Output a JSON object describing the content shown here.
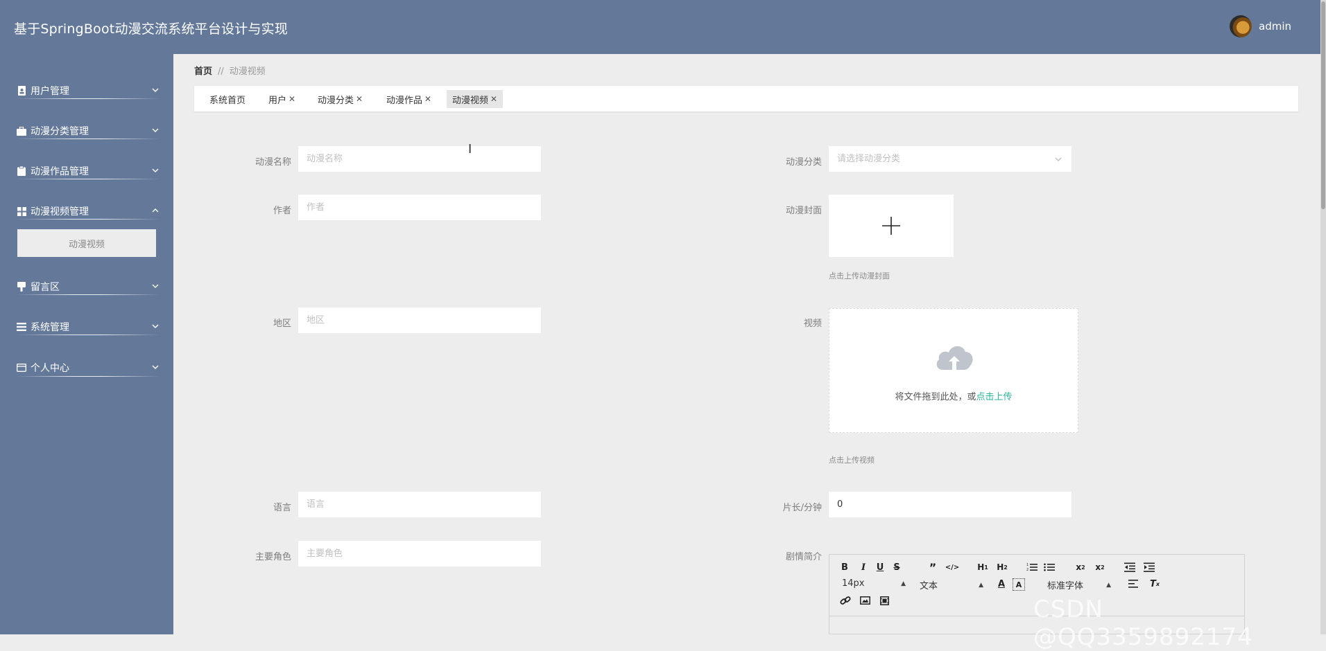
{
  "header": {
    "title": "基于SpringBoot动漫交流系统平台设计与实现",
    "username": "admin"
  },
  "sidebar": {
    "items": [
      {
        "label": "用户管理",
        "icon": "user-doc-icon"
      },
      {
        "label": "动漫分类管理",
        "icon": "briefcase-icon"
      },
      {
        "label": "动漫作品管理",
        "icon": "clipboard-icon"
      },
      {
        "label": "动漫视频管理",
        "icon": "grid-icon"
      },
      {
        "label": "留言区",
        "icon": "message-icon"
      },
      {
        "label": "系统管理",
        "icon": "list-icon"
      },
      {
        "label": "个人中心",
        "icon": "profile-card-icon"
      }
    ],
    "submenu_active": "动漫视频"
  },
  "breadcrumb": {
    "home": "首页",
    "separator": "//",
    "current": "动漫视频"
  },
  "tabs": [
    {
      "label": "系统首页"
    },
    {
      "label": "用户"
    },
    {
      "label": "动漫分类"
    },
    {
      "label": "动漫作品"
    },
    {
      "label": "动漫视频"
    }
  ],
  "form": {
    "name": {
      "label": "动漫名称",
      "placeholder": "动漫名称"
    },
    "category": {
      "label": "动漫分类",
      "placeholder": "请选择动漫分类"
    },
    "author": {
      "label": "作者",
      "placeholder": "作者"
    },
    "cover": {
      "label": "动漫封面",
      "hint": "点击上传动漫封面"
    },
    "region": {
      "label": "地区",
      "placeholder": "地区"
    },
    "video": {
      "label": "视频",
      "drop_text": "将文件拖到此处，或",
      "drop_link": "点击上传",
      "hint": "点击上传视频"
    },
    "language": {
      "label": "语言",
      "placeholder": "语言"
    },
    "duration": {
      "label": "片长/分钟",
      "value": "0"
    },
    "characters": {
      "label": "主要角色",
      "placeholder": "主要角色"
    },
    "synopsis": {
      "label": "剧情简介"
    }
  },
  "editor": {
    "font_size": "14px",
    "block_format": "文本",
    "font_family": "标准字体"
  },
  "watermark": "CSDN @QQ3359892174",
  "colors": {
    "sidebar": "#64799a",
    "link": "#2bb59b",
    "background": "#ededed"
  }
}
